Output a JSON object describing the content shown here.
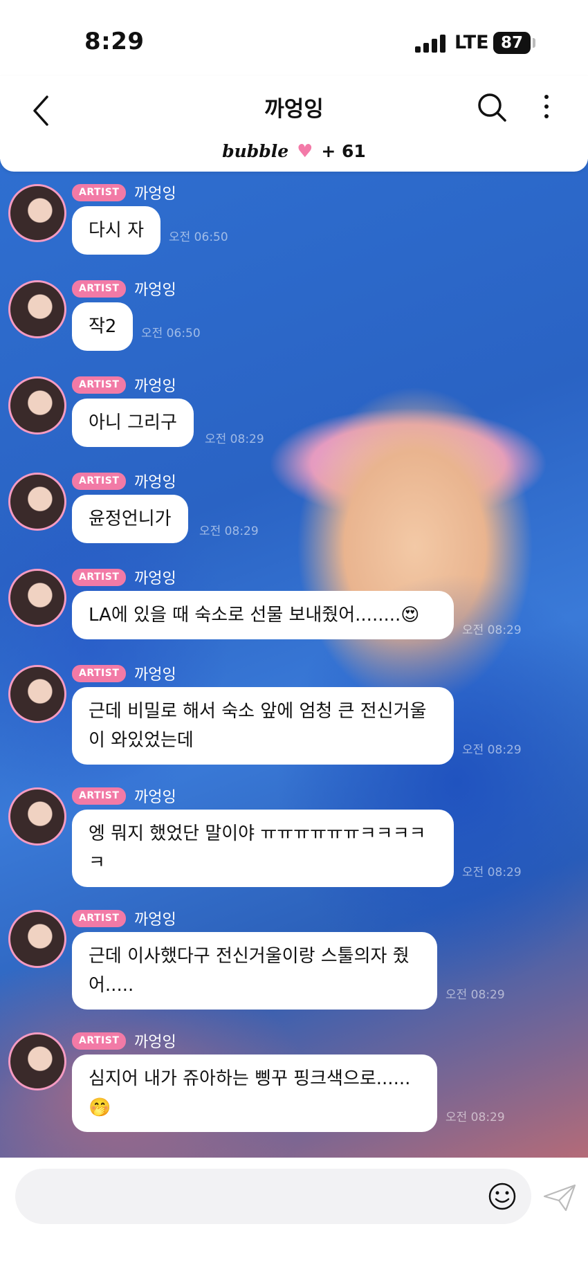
{
  "status": {
    "time": "8:29",
    "network": "LTE",
    "battery": "87"
  },
  "header": {
    "title": "까엉잉",
    "bubble_logo": "bubble",
    "bubble_count": "+ 61",
    "icons": {
      "back": "chevron-left-icon",
      "search": "search-icon",
      "more": "more-vertical-icon",
      "heart": "heart-icon"
    }
  },
  "chat": {
    "messages": [
      {
        "badge": "ARTIST",
        "name": "까엉잉",
        "text": "다시 자",
        "time": "오전 06:50"
      },
      {
        "badge": "ARTIST",
        "name": "까엉잉",
        "text": "작2",
        "time": "오전 06:50"
      },
      {
        "badge": "ARTIST",
        "name": "까엉잉",
        "text": "아니 그리구",
        "time": "오전 08:29"
      },
      {
        "badge": "ARTIST",
        "name": "까엉잉",
        "text": "윤정언니가",
        "time": "오전 08:29"
      },
      {
        "badge": "ARTIST",
        "name": "까엉잉",
        "text": "LA에 있을 때 숙소로 선물 보내줬어........😍",
        "time": "오전 08:29"
      },
      {
        "badge": "ARTIST",
        "name": "까엉잉",
        "line1": "근데 비밀로 해서 숙소 앞에 엄청 큰 전신거울",
        "line2": "이 와있었는데",
        "time": "오전 08:29"
      },
      {
        "badge": "ARTIST",
        "name": "까엉잉",
        "line1": "엥 뭐지 했었단 말이야 ㅠㅠㅠㅠㅠㅠㅋㅋㅋㅋ",
        "line2": "ㅋ",
        "time": "오전 08:29"
      },
      {
        "badge": "ARTIST",
        "name": "까엉잉",
        "line1": "근데 이사했다구 전신거울이랑 스툴의자 줬",
        "line2": "어.....",
        "time": "오전 08:29"
      },
      {
        "badge": "ARTIST",
        "name": "까엉잉",
        "line1": "심지어 내가 쥬아하는 삥꾸 핑크색으로......",
        "line2": "🤭",
        "time": "오전 08:29"
      }
    ]
  },
  "input": {
    "emoji_icon": "smiley-icon",
    "send_icon": "send-icon"
  },
  "colors": {
    "accent_pink": "#f27aa6",
    "avatar_ring": "#f59bc2"
  }
}
